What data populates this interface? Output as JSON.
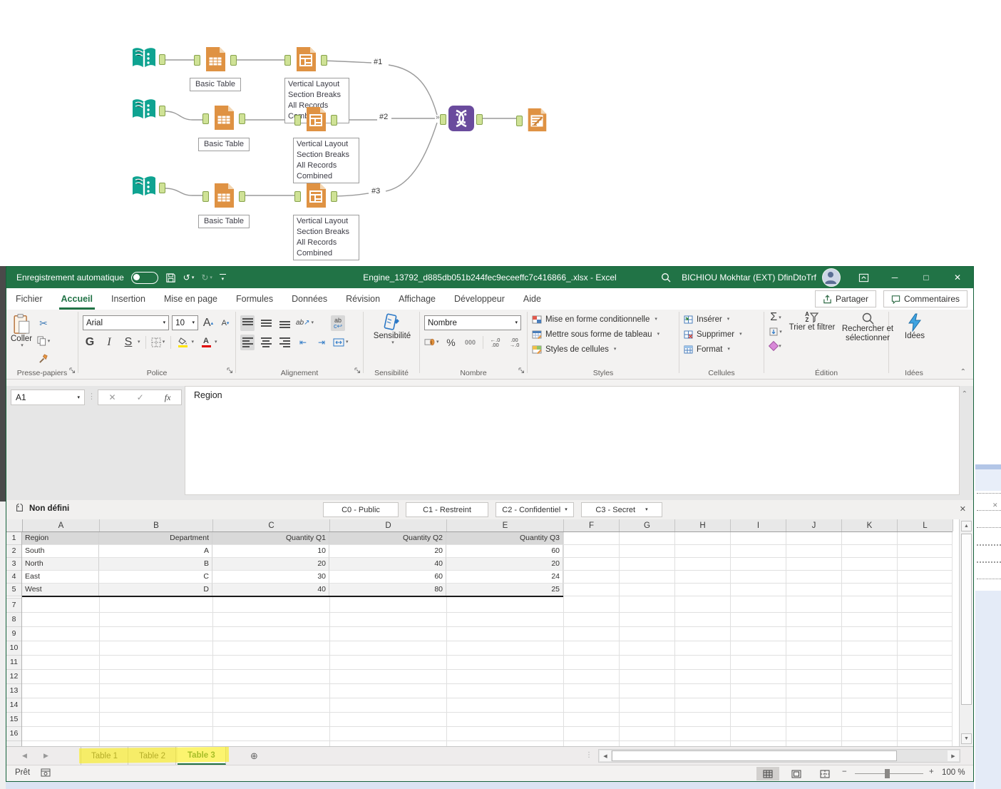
{
  "workflow": {
    "basic_table_label": "Basic Table",
    "annotation_lines": [
      "Vertical Layout",
      "Section Breaks",
      "All Records",
      "Combined"
    ],
    "connection_labels": {
      "c1": "#1",
      "c2": "#2",
      "c3": "#3"
    },
    "colors": {
      "input_teal": "#0fa391",
      "tool_orange": "#df9243",
      "union_purple": "#6a4b9d",
      "anchor_green": "#cfe296"
    }
  },
  "titlebar": {
    "autosave": "Enregistrement automatique",
    "title": "Engine_13792_d885db051b244fec9eceeffc7c416866_.xlsx  -  Excel",
    "user": "BICHIOU Mokhtar (EXT) DfinDtoTrf"
  },
  "tabs": {
    "items": [
      "Fichier",
      "Accueil",
      "Insertion",
      "Mise en page",
      "Formules",
      "Données",
      "Révision",
      "Affichage",
      "Développeur",
      "Aide"
    ],
    "share": "Partager",
    "comments": "Commentaires"
  },
  "ribbon": {
    "clipboard": {
      "paste": "Coller",
      "group": "Presse-papiers"
    },
    "font": {
      "family": "Arial",
      "size": "10",
      "bold": "G",
      "italic": "I",
      "underline": "S",
      "group": "Police"
    },
    "alignment": {
      "orientation": "ab",
      "wrap": "ab",
      "group": "Alignement"
    },
    "sensitivity": {
      "label": "Sensibilité",
      "group": "Sensibilité"
    },
    "number": {
      "format": "Nombre",
      "percent": "%",
      "thousands": "000",
      "dec_more": "←.0",
      "dec_more2": ".00",
      "dec_less": ".00",
      "dec_less2": "→.0",
      "group": "Nombre"
    },
    "styles": {
      "conditional": "Mise en forme conditionnelle",
      "format_table": "Mettre sous forme de tableau",
      "cell_styles": "Styles de cellules",
      "group": "Styles"
    },
    "cells": {
      "insert": "Insérer",
      "delete": "Supprimer",
      "format": "Format",
      "group": "Cellules"
    },
    "editing": {
      "autosum": "Σ",
      "sort": "Trier et filtrer",
      "find": "Rechercher et sélectionner",
      "group": "Édition"
    },
    "ideas": {
      "label": "Idées",
      "group": "Idées"
    }
  },
  "formula_bar": {
    "name_box": "A1",
    "fx": "fx",
    "value": "Region"
  },
  "classification": {
    "current": "Non défini",
    "options": [
      "C0 - Public",
      "C1 - Restreint",
      "C2 - Confidentiel",
      "C3 - Secret"
    ]
  },
  "grid": {
    "columns": [
      "A",
      "B",
      "C",
      "D",
      "E",
      "F",
      "G",
      "H",
      "I",
      "J",
      "K",
      "L"
    ],
    "rows_visible": [
      "1",
      "2",
      "3",
      "4",
      "5",
      "7",
      "8",
      "9",
      "10",
      "11",
      "12",
      "13",
      "14",
      "15",
      "16"
    ],
    "table": {
      "headers": [
        "Region",
        "Department",
        "Quantity Q1",
        "Quantity Q2",
        "Quantity Q3"
      ],
      "rows": [
        [
          "South",
          "A",
          "10",
          "20",
          "60"
        ],
        [
          "North",
          "B",
          "20",
          "40",
          "20"
        ],
        [
          "East",
          "C",
          "30",
          "60",
          "24"
        ],
        [
          "West",
          "D",
          "40",
          "80",
          "25"
        ]
      ]
    }
  },
  "sheet_bar": {
    "tabs": [
      "Table 1",
      "Table 2",
      "Table 3"
    ],
    "active": "Table 3"
  },
  "status_bar": {
    "mode": "Prêt",
    "zoom": "100 %"
  }
}
